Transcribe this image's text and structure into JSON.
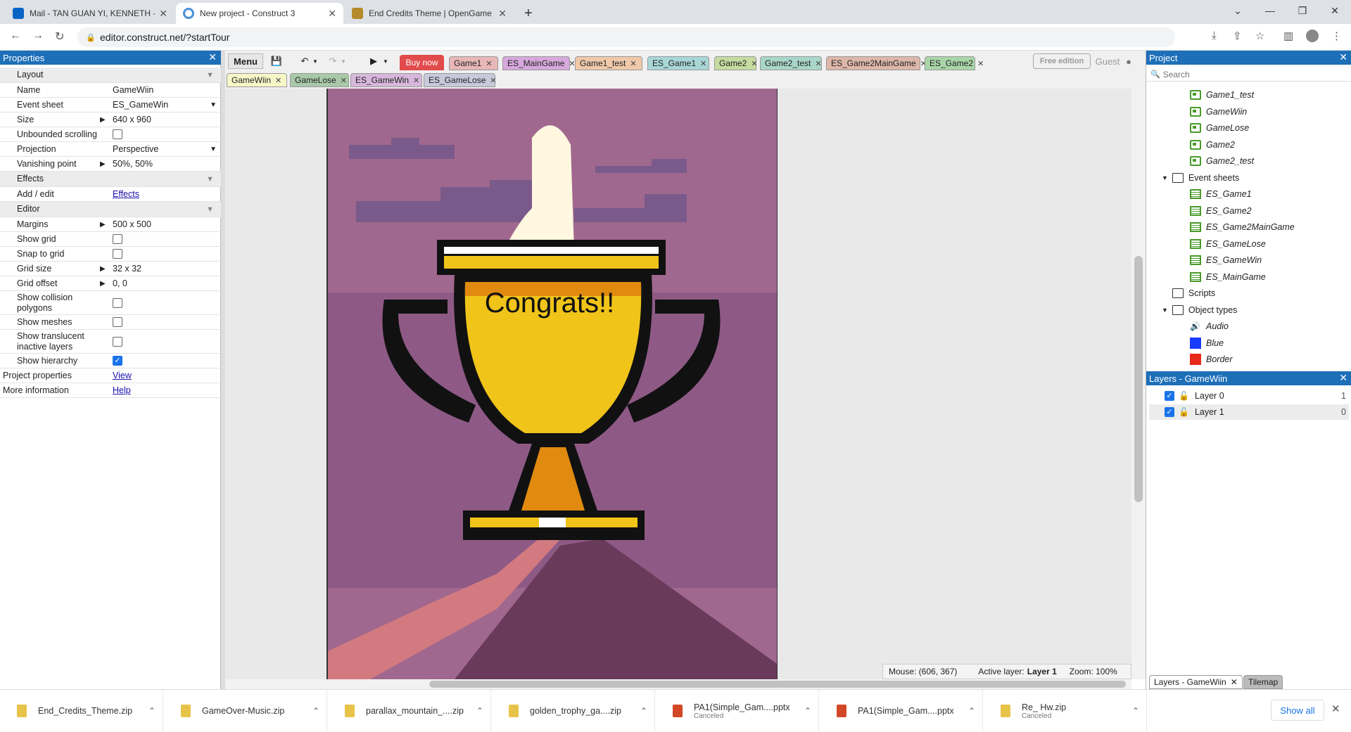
{
  "browser": {
    "tabs": [
      {
        "title": "Mail - TAN GUAN YI, KENNETH -",
        "favicon_color": "#0a64c8"
      },
      {
        "title": "New project - Construct 3",
        "favicon_color": "#4a90d9"
      },
      {
        "title": "End Credits Theme | OpenGame",
        "favicon_color": "#b48a2a"
      }
    ],
    "url": "editor.construct.net/?startTour"
  },
  "properties": {
    "title": "Properties",
    "rows": [
      {
        "kind": "section",
        "label": "Layout"
      },
      {
        "kind": "text",
        "label": "Name",
        "value": "GameWiin"
      },
      {
        "kind": "select",
        "label": "Event sheet",
        "value": "ES_GameWin"
      },
      {
        "kind": "expand",
        "label": "Size",
        "value": "640 x 960"
      },
      {
        "kind": "check",
        "label": "Unbounded scrolling",
        "checked": false
      },
      {
        "kind": "select",
        "label": "Projection",
        "value": "Perspective"
      },
      {
        "kind": "expand",
        "label": "Vanishing point",
        "value": "50%, 50%"
      },
      {
        "kind": "section",
        "label": "Effects"
      },
      {
        "kind": "link",
        "label": "Add / edit",
        "value": "Effects"
      },
      {
        "kind": "section",
        "label": "Editor"
      },
      {
        "kind": "expand",
        "label": "Margins",
        "value": "500 x 500"
      },
      {
        "kind": "check",
        "label": "Show grid",
        "checked": false
      },
      {
        "kind": "check",
        "label": "Snap to grid",
        "checked": false
      },
      {
        "kind": "expand",
        "label": "Grid size",
        "value": "32 x 32"
      },
      {
        "kind": "expand",
        "label": "Grid offset",
        "value": "0, 0"
      },
      {
        "kind": "check",
        "label": "Show collision polygons",
        "checked": false,
        "tall": true
      },
      {
        "kind": "check",
        "label": "Show meshes",
        "checked": false
      },
      {
        "kind": "check",
        "label": "Show translucent inactive layers",
        "checked": false,
        "tall": true
      },
      {
        "kind": "check",
        "label": "Show hierarchy",
        "checked": true
      },
      {
        "kind": "toplink",
        "label": "Project properties",
        "value": "View"
      },
      {
        "kind": "toplink",
        "label": "More information",
        "value": "Help"
      }
    ]
  },
  "toolbar": {
    "menu_label": "Menu",
    "buy_label": "Buy now",
    "free_edition": "Free edition",
    "guest": "Guest"
  },
  "editor_tabs_row1": [
    {
      "label": "Game1",
      "color": "#e9b7b7"
    },
    {
      "label": "ES_MainGame",
      "color": "#d7a8dc"
    },
    {
      "label": "Game1_test",
      "color": "#efc9a9"
    },
    {
      "label": "ES_Game1",
      "color": "#a9d6d6"
    },
    {
      "label": "Game2",
      "color": "#c5dba0"
    },
    {
      "label": "Game2_test",
      "color": "#a9d6c9"
    },
    {
      "label": "ES_Game2MainGame",
      "color": "#ddb7a9"
    },
    {
      "label": "ES_Game2",
      "color": "#a9d6a9"
    }
  ],
  "editor_tabs_row2": [
    {
      "label": "GameWiin",
      "color": "#f7f7c9",
      "active": true
    },
    {
      "label": "GameLose",
      "color": "#a9c9a9"
    },
    {
      "label": "ES_GameWin",
      "color": "#d7b7dc"
    },
    {
      "label": "ES_GameLose",
      "color": "#c9c9dc"
    }
  ],
  "canvas": {
    "trophy_text": "Congrats!!",
    "colors": {
      "sky": "#a0688e",
      "cloud": "#7a5a8a",
      "mountain": "#6a3a5a",
      "trophy": "#f0c419",
      "trophy_dark": "#e08a10"
    }
  },
  "status": {
    "mouse": "Mouse: (606, 367)",
    "active_layer_label": "Active layer:",
    "active_layer": "Layer 1",
    "zoom": "Zoom: 100%"
  },
  "project": {
    "title": "Project",
    "search_placeholder": "Search",
    "items": [
      {
        "label": "Game1_test",
        "icon": "layout",
        "depth": 2
      },
      {
        "label": "GameWiin",
        "icon": "layout",
        "depth": 2
      },
      {
        "label": "GameLose",
        "icon": "layout",
        "depth": 2
      },
      {
        "label": "Game2",
        "icon": "layout",
        "depth": 2
      },
      {
        "label": "Game2_test",
        "icon": "layout",
        "depth": 2
      },
      {
        "label": "Event sheets",
        "icon": "folder",
        "depth": 1
      },
      {
        "label": "ES_Game1",
        "icon": "sheet",
        "depth": 2
      },
      {
        "label": "ES_Game2",
        "icon": "sheet",
        "depth": 2
      },
      {
        "label": "ES_Game2MainGame",
        "icon": "sheet",
        "depth": 2
      },
      {
        "label": "ES_GameLose",
        "icon": "sheet",
        "depth": 2
      },
      {
        "label": "ES_GameWin",
        "icon": "sheet",
        "depth": 2
      },
      {
        "label": "ES_MainGame",
        "icon": "sheet",
        "depth": 2
      },
      {
        "label": "Scripts",
        "icon": "folder",
        "depth": 1
      },
      {
        "label": "Object types",
        "icon": "folder",
        "depth": 1
      },
      {
        "label": "Audio",
        "icon": "audio",
        "depth": 2
      },
      {
        "label": "Blue",
        "icon": "blue",
        "depth": 2
      },
      {
        "label": "Border",
        "icon": "red",
        "depth": 2
      }
    ]
  },
  "layers": {
    "title": "Layers - GameWiin",
    "rows": [
      {
        "label": "Layer 0",
        "index": "1"
      },
      {
        "label": "Layer 1",
        "index": "0"
      }
    ],
    "bottom_tabs": [
      "Layers - GameWiin",
      "Tilemap"
    ]
  },
  "downloads": [
    {
      "name": "End_Credits_Theme.zip",
      "sub": "",
      "icon": "zip"
    },
    {
      "name": "GameOver-Music.zip",
      "sub": "",
      "icon": "zip"
    },
    {
      "name": "parallax_mountain_....zip",
      "sub": "",
      "icon": "zip"
    },
    {
      "name": "golden_trophy_ga....zip",
      "sub": "",
      "icon": "zip"
    },
    {
      "name": "PA1(Simple_Gam....pptx",
      "sub": "Canceled",
      "icon": "pptx"
    },
    {
      "name": "PA1(Simple_Gam....pptx",
      "sub": "",
      "icon": "pptx"
    },
    {
      "name": "Re_ Hw.zip",
      "sub": "Canceled",
      "icon": "zip"
    }
  ],
  "show_all": "Show all"
}
